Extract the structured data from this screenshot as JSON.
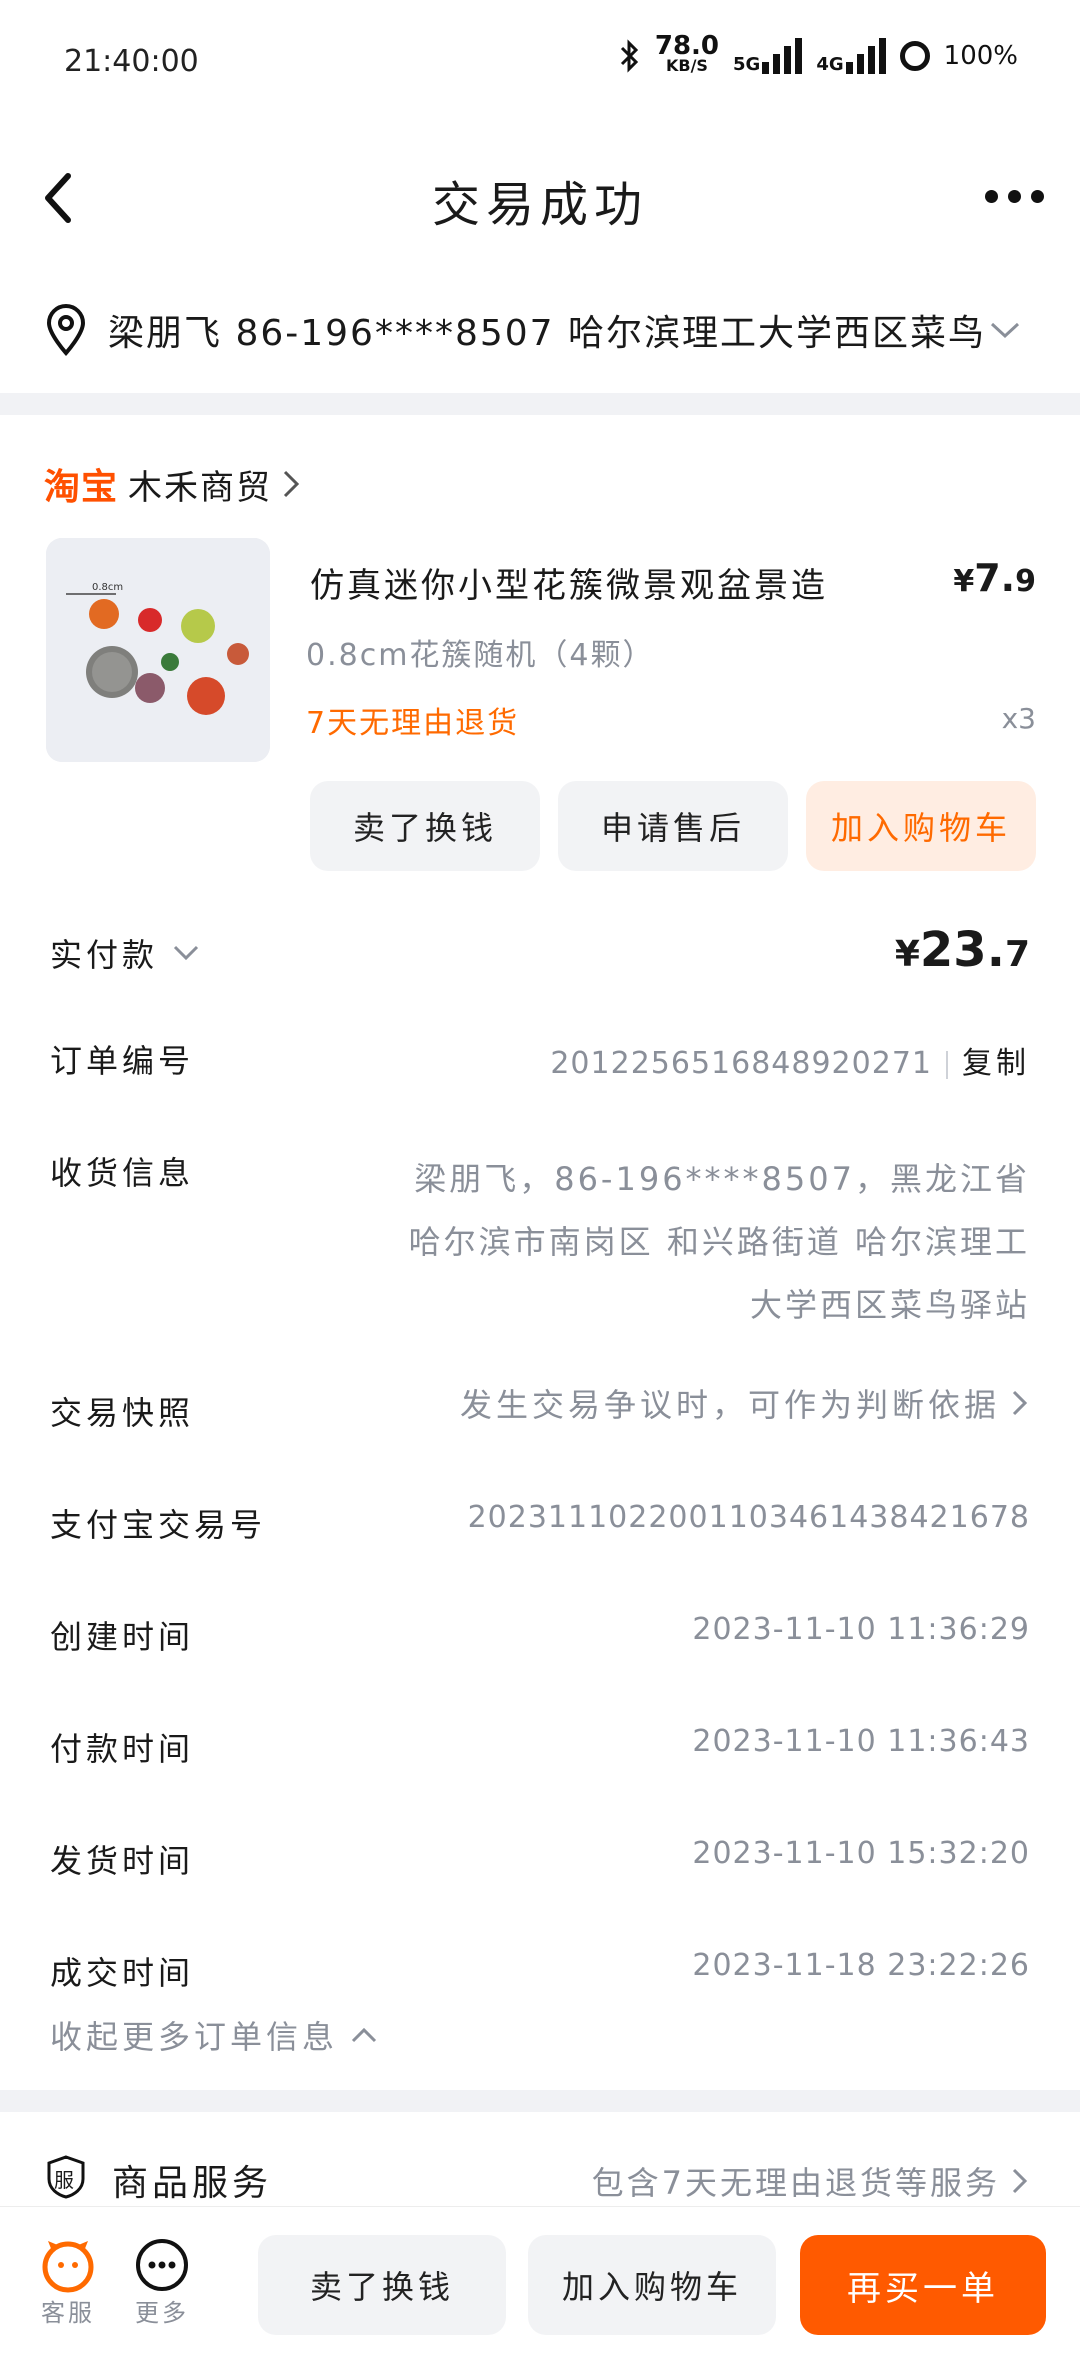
{
  "status_bar": {
    "time": "21:40:00",
    "net_speed": "78.0",
    "net_unit": "KB/S",
    "net1": "5G",
    "net2": "4G",
    "battery": "100%"
  },
  "header": {
    "title": "交易成功"
  },
  "address_bar": {
    "text": "梁朋飞 86-196****8507 哈尔滨理工大学西区菜鸟…"
  },
  "store": {
    "brand": "淘宝",
    "name": "木禾商贸"
  },
  "product": {
    "title": "仿真迷你小型花簇微景观盆景造",
    "price_symbol": "¥",
    "price_int": "7.",
    "price_dec": "9",
    "spec": "0.8cm花簇随机（4颗）",
    "return_tag": "7天无理由退货",
    "quantity": "x3",
    "btn_sell": "卖了换钱",
    "btn_after_sale": "申请售后",
    "btn_add_cart": "加入购物车",
    "thumb_label": "0.8cm"
  },
  "order": {
    "paid_label": "实付款",
    "paid_symbol": "¥",
    "paid_int": "23.",
    "paid_dec": "7",
    "order_no_label": "订单编号",
    "order_no": "2012256516848920271",
    "copy_label": "复制",
    "shipping_label": "收货信息",
    "shipping_value": "梁朋飞，86-196****8507，黑龙江省哈尔滨市南岗区 和兴路街道 哈尔滨理工大学西区菜鸟驿站",
    "snapshot_label": "交易快照",
    "snapshot_value": "发生交易争议时，可作为判断依据",
    "alipay_label": "支付宝交易号",
    "alipay_value": "2023111022001103461438421678",
    "created_label": "创建时间",
    "created_value": "2023-11-10 11:36:29",
    "paid_time_label": "付款时间",
    "paid_time_value": "2023-11-10 11:36:43",
    "shipped_label": "发货时间",
    "shipped_value": "2023-11-10 15:32:20",
    "deal_label": "成交时间",
    "deal_value": "2023-11-18 23:22:26",
    "collapse_label": "收起更多订单信息"
  },
  "service": {
    "icon_char": "服",
    "title": "商品服务",
    "value": "包含7天无理由退货等服务"
  },
  "bottom_bar": {
    "service_label": "客服",
    "more_label": "更多",
    "btn_sell": "卖了换钱",
    "btn_cart": "加入购物车",
    "btn_rebuy": "再买一单"
  },
  "colors": {
    "accent": "#ff5000",
    "grey_text": "#8a8f99",
    "divider": "#f1f2f5"
  }
}
